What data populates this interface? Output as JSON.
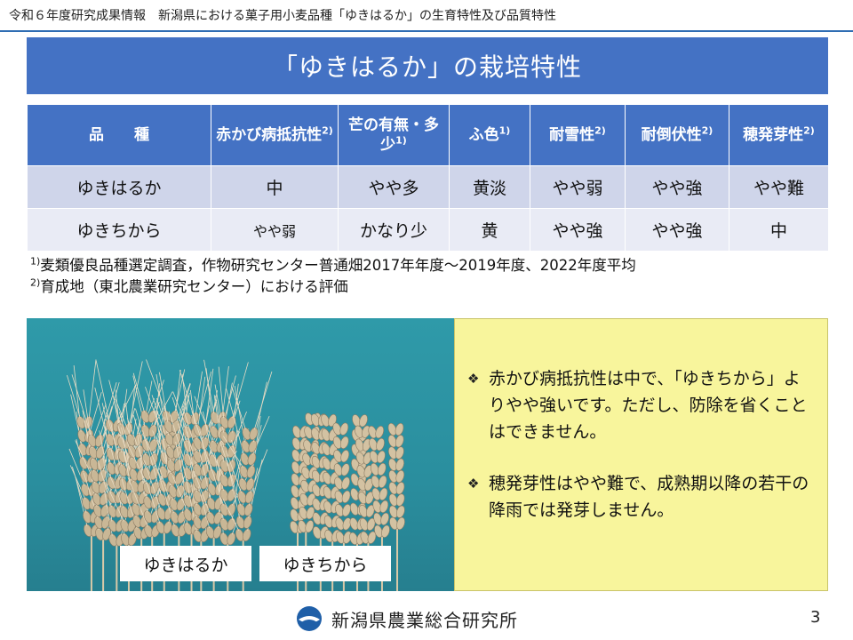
{
  "header": {
    "text": "令和６年度研究成果情報　新潟県における菓子用小麦品種「ゆきはるか」の生育特性及び品質特性"
  },
  "title": "「ゆきはるか」の栽培特性",
  "table": {
    "headers": [
      {
        "label": "品　　種",
        "sup": ""
      },
      {
        "label": "赤かび病抵抗性",
        "sup": "2)"
      },
      {
        "label": "芒の有無・多少",
        "sup": "1)"
      },
      {
        "label": "ふ色",
        "sup": "1)"
      },
      {
        "label": "耐雪性",
        "sup": "2)"
      },
      {
        "label": "耐倒伏性",
        "sup": "2)"
      },
      {
        "label": "穂発芽性",
        "sup": "2)"
      }
    ],
    "rows": [
      [
        "ゆきはるか",
        "中",
        "やや多",
        "黄淡",
        "やや弱",
        "やや強",
        "やや難"
      ],
      [
        "ゆきちから",
        "やや弱",
        "かなり少",
        "黄",
        "やや強",
        "やや強",
        "中"
      ]
    ]
  },
  "notes": [
    {
      "sup": "1)",
      "text": "麦類優良品種選定調査，作物研究センター普通畑2017年年度～2019年度、2022年度平均"
    },
    {
      "sup": "2)",
      "text": "育成地（東北農業研究センター）における評価"
    }
  ],
  "photo": {
    "labels": [
      "ゆきはるか",
      "ゆきちから"
    ]
  },
  "description": {
    "bullets": [
      "赤かび病抵抗性は中で、「ゆきちから」よりやや強いです。ただし、防除を省くことはできません。",
      "穂発芽性はやや難で、成熟期以降の若干の降雨では発芽しません。"
    ]
  },
  "footer": {
    "org": "新潟県農業総合研究所",
    "page": "3"
  },
  "colors": {
    "accent": "#4472c4",
    "row_odd": "#cfd5ea",
    "row_even": "#e9ebf5",
    "note_box": "#f8f59c",
    "photo_bg": "#2f9aa9"
  },
  "icons": [
    "bullet-diamond-icon",
    "institute-logo-icon"
  ]
}
